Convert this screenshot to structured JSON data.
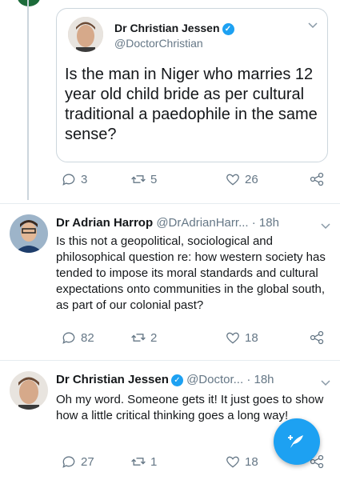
{
  "quoted": {
    "name": "Dr Christian Jessen",
    "handle": "@DoctorChristian",
    "text": "Is the man in Niger who marries 12 year old child bride as per cultural traditional a paedophile in the same sense?"
  },
  "main_actions": {
    "replies": "3",
    "retweets": "5",
    "likes": "26"
  },
  "replies": [
    {
      "name": "Dr Adrian Harrop",
      "handle": "@DrAdrianHarr...",
      "time": "· 18h",
      "text": "Is this not a geopolitical, sociological and philosophical question re: how western society has tended to impose its moral standards and cultural expectations onto communities in the global south, as part of our colonial past?",
      "replies": "82",
      "retweets": "2",
      "likes": "18"
    },
    {
      "name": "Dr Christian Jessen",
      "handle": "@Doctor...",
      "time": "· 18h",
      "text": "Oh my word. Someone gets it! It just goes to show how a little critical thinking goes a long way!",
      "replies": "27",
      "retweets": "1",
      "likes": "18"
    }
  ],
  "colors": {
    "accent": "#1da1f2",
    "muted": "#657786"
  },
  "icons": [
    "reply-icon",
    "retweet-icon",
    "like-icon",
    "share-icon",
    "verified-icon",
    "chevron-down-icon",
    "compose-icon"
  ]
}
